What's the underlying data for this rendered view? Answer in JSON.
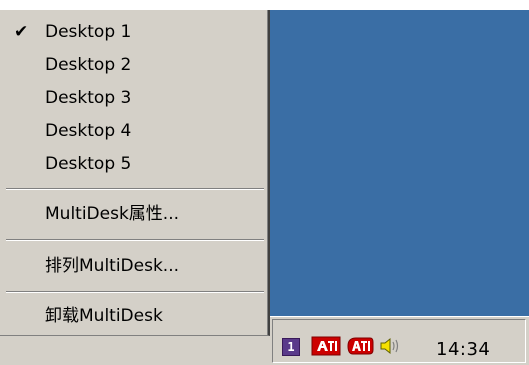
{
  "menu": {
    "items": [
      {
        "label": "Desktop 1",
        "checked": true
      },
      {
        "label": "Desktop 2",
        "checked": false
      },
      {
        "label": "Desktop 3",
        "checked": false
      },
      {
        "label": "Desktop 4",
        "checked": false
      },
      {
        "label": "Desktop 5",
        "checked": false
      }
    ],
    "check_glyph": "✔",
    "properties_label": "MultiDesk属性...",
    "arrange_label": "排列MultiDesk...",
    "unload_label": "卸载MultiDesk"
  },
  "tray": {
    "desktop_indicator": "1",
    "icons": [
      "ati-icon",
      "ati-icon",
      "speaker-icon"
    ],
    "clock": "14:34"
  },
  "colors": {
    "desktop": "#3a6ea5",
    "menu_bg": "#d4d0c8",
    "ati_red": "#cc0000"
  }
}
